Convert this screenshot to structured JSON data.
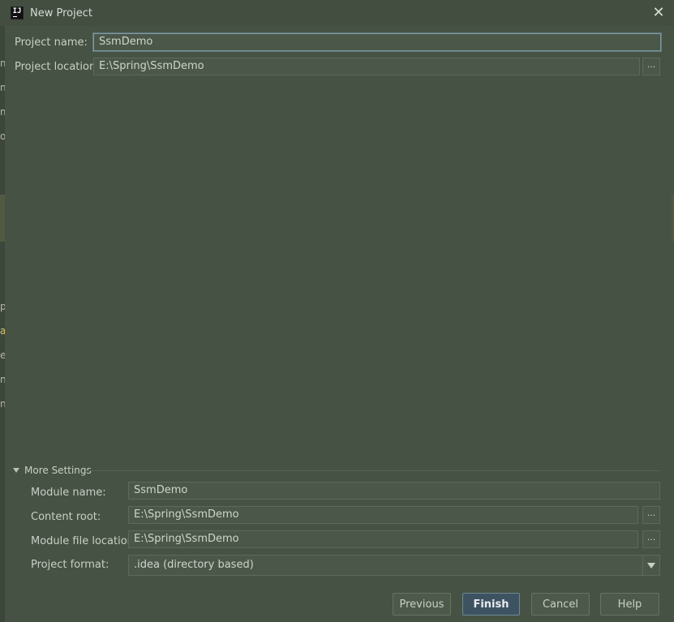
{
  "window": {
    "title": "New Project",
    "logo_text": "IJ"
  },
  "background_chars": [
    "m",
    "n",
    "m",
    "o",
    "p",
    "a",
    "e",
    "n",
    "n"
  ],
  "project": {
    "name_label": "Project name:",
    "name_value": "SsmDemo",
    "location_label": "Project location:",
    "location_value": "E:\\Spring\\SsmDemo",
    "browse": "..."
  },
  "more_settings": {
    "label": "More Settings",
    "module_name_label": "Module name:",
    "module_name_value": "SsmDemo",
    "content_root_label": "Content root:",
    "content_root_value": "E:\\Spring\\SsmDemo",
    "module_file_label": "Module file location:",
    "module_file_value": "E:\\Spring\\SsmDemo",
    "format_label": "Project format:",
    "format_value": ".idea (directory based)",
    "browse": "..."
  },
  "buttons": {
    "previous": "Previous",
    "finish": "Finish",
    "cancel": "Cancel",
    "help": "Help"
  },
  "colors": {
    "dialog_bg": "#465244",
    "focus_border": "#7e9a9c",
    "primary_button": "#3e5362"
  }
}
